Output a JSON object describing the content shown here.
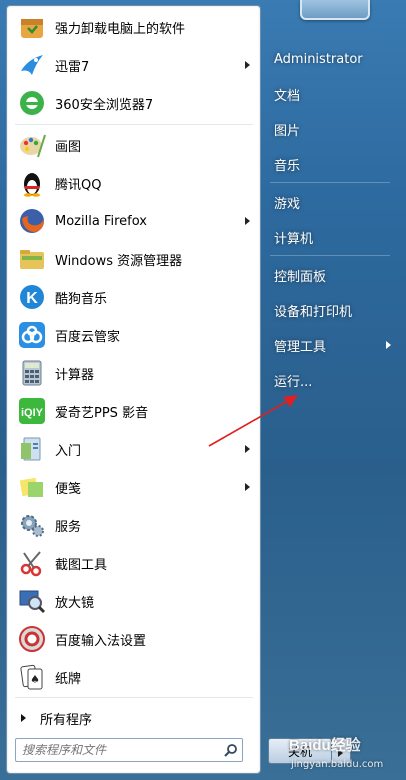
{
  "left_panel": {
    "items": [
      {
        "label": "强力卸载电脑上的软件",
        "icon": "uninstall-box-icon",
        "submenu": false
      },
      {
        "label": "迅雷7",
        "icon": "thunder-bird-icon",
        "submenu": true
      },
      {
        "label": "360安全浏览器7",
        "icon": "360-browser-icon",
        "submenu": false
      },
      {
        "label": "画图",
        "icon": "paint-palette-icon",
        "submenu": false
      },
      {
        "label": "腾讯QQ",
        "icon": "qq-penguin-icon",
        "submenu": false
      },
      {
        "label": "Mozilla Firefox",
        "icon": "firefox-icon",
        "submenu": true
      },
      {
        "label": "Windows 资源管理器",
        "icon": "folder-explorer-icon",
        "submenu": false
      },
      {
        "label": "酷狗音乐",
        "icon": "kugou-icon",
        "submenu": false
      },
      {
        "label": "百度云管家",
        "icon": "baidu-cloud-icon",
        "submenu": false
      },
      {
        "label": "计算器",
        "icon": "calculator-icon",
        "submenu": false
      },
      {
        "label": "爱奇艺PPS 影音",
        "icon": "iqiyi-icon",
        "submenu": false
      },
      {
        "label": "入门",
        "icon": "getting-started-icon",
        "submenu": true
      },
      {
        "label": "便笺",
        "icon": "sticky-notes-icon",
        "submenu": true
      },
      {
        "label": "服务",
        "icon": "services-gear-icon",
        "submenu": false
      },
      {
        "label": "截图工具",
        "icon": "snipping-tool-icon",
        "submenu": false
      },
      {
        "label": "放大镜",
        "icon": "magnifier-icon",
        "submenu": false
      },
      {
        "label": "百度输入法设置",
        "icon": "baidu-ime-icon",
        "submenu": false
      },
      {
        "label": "纸牌",
        "icon": "solitaire-cards-icon",
        "submenu": false
      }
    ],
    "all_programs": "所有程序",
    "search_placeholder": "搜索程序和文件"
  },
  "right_panel": {
    "items": [
      {
        "label": "Administrator",
        "submenu": false
      },
      {
        "label": "文档",
        "submenu": false
      },
      {
        "label": "图片",
        "submenu": false
      },
      {
        "label": "音乐",
        "submenu": false
      },
      {
        "label": "游戏",
        "submenu": false
      },
      {
        "label": "计算机",
        "submenu": false
      },
      {
        "label": "控制面板",
        "submenu": false
      },
      {
        "label": "设备和打印机",
        "submenu": false
      },
      {
        "label": "管理工具",
        "submenu": true
      },
      {
        "label": "运行...",
        "submenu": false
      }
    ],
    "shutdown_label": "关机"
  },
  "watermark": {
    "line1": "Baidu经验",
    "line2": "jingyan.baidu.com"
  },
  "colors": {
    "annotation_arrow": "#e02020",
    "panel_bg": "#ffffff",
    "menu_bg": "#2d6a9f"
  }
}
